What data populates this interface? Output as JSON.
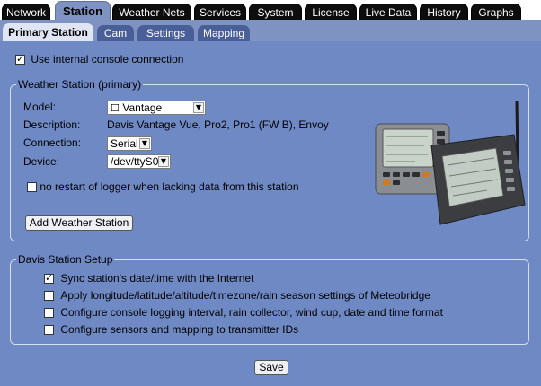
{
  "top_tabs": [
    "Network",
    "Station",
    "Weather Nets",
    "Services",
    "System",
    "License",
    "Live Data",
    "History",
    "Graphs"
  ],
  "active_top_tab": "Station",
  "sub_tabs": [
    "Primary Station",
    "Cam",
    "Settings",
    "Mapping"
  ],
  "active_sub_tab": "Primary Station",
  "use_internal_console": {
    "label": "Use internal console connection",
    "checked": true
  },
  "weather_station": {
    "legend": "Weather Station (primary)",
    "model_label": "Model:",
    "model_value": "Vantage",
    "description_label": "Description:",
    "description_value": "Davis Vantage Vue, Pro2, Pro1 (FW B), Envoy",
    "connection_label": "Connection:",
    "connection_value": "Serial",
    "device_label": "Device:",
    "device_value": "/dev/ttyS0",
    "no_restart": {
      "label": "no restart of logger when lacking data from this station",
      "checked": false
    },
    "add_button": "Add Weather Station"
  },
  "davis_setup": {
    "legend": "Davis Station Setup",
    "options": [
      {
        "label": "Sync station's date/time with the Internet",
        "checked": true
      },
      {
        "label": "Apply longitude/latitude/altitude/timezone/rain season settings of Meteobridge",
        "checked": false
      },
      {
        "label": "Configure console logging interval, rain collector, wind cup, date and time format",
        "checked": false
      },
      {
        "label": "Configure sensors and mapping to transmitter IDs",
        "checked": false
      }
    ]
  },
  "save_button": "Save"
}
